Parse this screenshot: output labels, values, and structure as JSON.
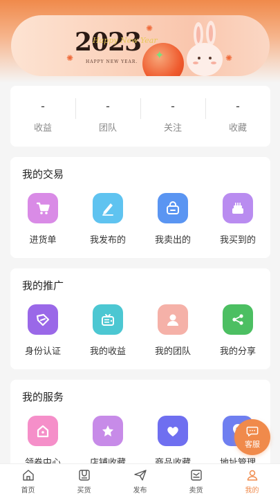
{
  "banner": {
    "year": "2023",
    "script": "Happy New Year",
    "subtitle": "HAPPY NEW YEAR."
  },
  "stats": [
    {
      "value": "-",
      "label": "收益"
    },
    {
      "value": "-",
      "label": "团队"
    },
    {
      "value": "-",
      "label": "关注"
    },
    {
      "value": "-",
      "label": "收藏"
    }
  ],
  "sections": {
    "trade": {
      "title": "我的交易",
      "items": [
        {
          "label": "进货单",
          "icon": "cart-icon",
          "color": "#d98be6"
        },
        {
          "label": "我发布的",
          "icon": "pen-icon",
          "color": "#5fc3f0"
        },
        {
          "label": "我卖出的",
          "icon": "basket-icon",
          "color": "#5a95f2"
        },
        {
          "label": "我买到的",
          "icon": "cake-icon",
          "color": "#b98cf0"
        }
      ]
    },
    "promo": {
      "title": "我的推广",
      "items": [
        {
          "label": "身份认证",
          "icon": "tag-icon",
          "color": "#9a68e8"
        },
        {
          "label": "我的收益",
          "icon": "tv-icon",
          "color": "#4cc7d2"
        },
        {
          "label": "我的团队",
          "icon": "person-icon",
          "color": "#f5b1a8"
        },
        {
          "label": "我的分享",
          "icon": "share-icon",
          "color": "#4cbf62"
        }
      ]
    },
    "service": {
      "title": "我的服务",
      "items": [
        {
          "label": "领券中心",
          "icon": "house-icon",
          "color": "#f58fc9"
        },
        {
          "label": "店铺收藏",
          "icon": "star-icon",
          "color": "#c78be8"
        },
        {
          "label": "商品收藏",
          "icon": "heart-icon",
          "color": "#6f6ff0"
        },
        {
          "label": "地址管理",
          "icon": "location-icon",
          "color": "#6f7ff0"
        }
      ]
    }
  },
  "fab": {
    "label": "客服"
  },
  "tabbar": {
    "accent": "#f08a4b",
    "items": [
      {
        "label": "首页",
        "icon": "home-icon"
      },
      {
        "label": "买货",
        "icon": "buy-icon"
      },
      {
        "label": "发布",
        "icon": "send-icon"
      },
      {
        "label": "卖货",
        "icon": "sell-icon"
      },
      {
        "label": "我的",
        "icon": "user-icon",
        "active": true
      }
    ]
  }
}
